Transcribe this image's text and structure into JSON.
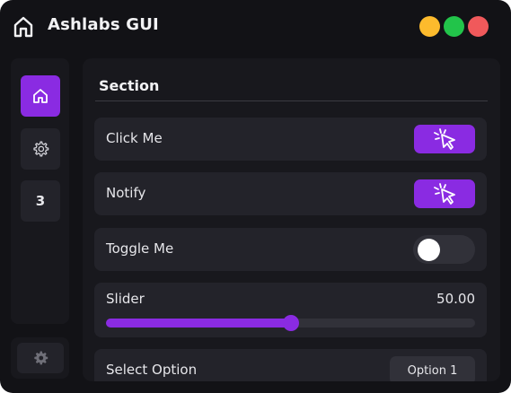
{
  "window": {
    "title": "Ashlabs GUI",
    "app_icon": "home-icon",
    "controls": [
      {
        "name": "minimize",
        "color": "#fdbb2d"
      },
      {
        "name": "maximize",
        "color": "#22c44a"
      },
      {
        "name": "close",
        "color": "#f0595b"
      }
    ]
  },
  "theme": {
    "accent": "#8a2be2",
    "background": "#121216",
    "panel": "#18181d",
    "row": "#23232a"
  },
  "sidebar": {
    "items": [
      {
        "icon": "home-icon",
        "label": "",
        "active": true
      },
      {
        "icon": "gear-icon",
        "label": "",
        "active": false
      },
      {
        "icon": "",
        "label": "3",
        "active": false
      }
    ],
    "bottom_icon": "gear-icon"
  },
  "main": {
    "section_title": "Section",
    "rows": {
      "click_me": {
        "label": "Click Me",
        "icon": "cursor-click-icon"
      },
      "notify": {
        "label": "Notify",
        "icon": "cursor-click-icon"
      },
      "toggle_me": {
        "label": "Toggle Me",
        "state": false
      },
      "slider": {
        "label": "Slider",
        "value_text": "50.00",
        "value": 50,
        "min": 0,
        "max": 100
      },
      "select_option": {
        "label": "Select Option",
        "selected": "Option 1"
      }
    }
  }
}
